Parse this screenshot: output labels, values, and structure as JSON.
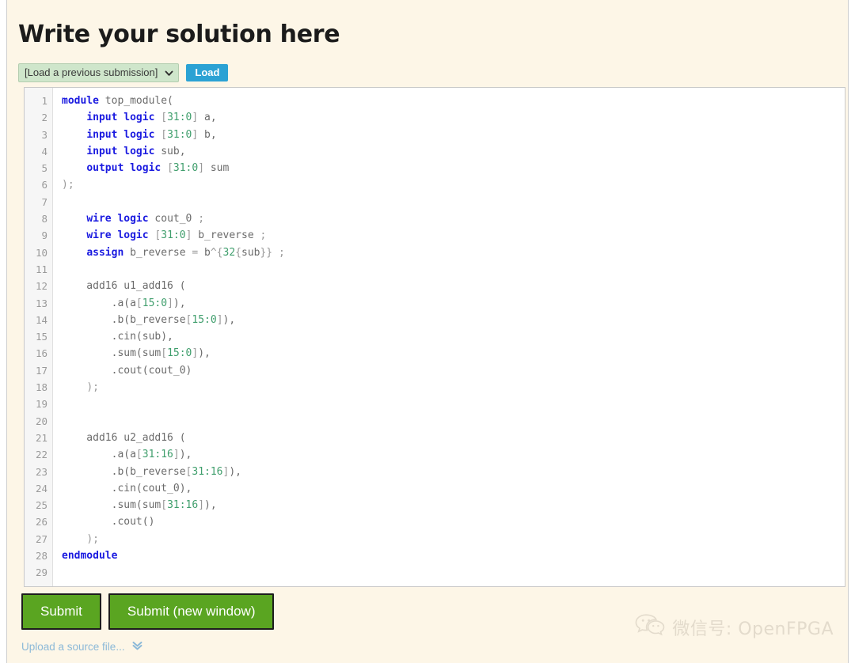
{
  "page": {
    "title": "Write your solution here",
    "background_color": "#fdf6e7"
  },
  "loader": {
    "select_value": "[Load a previous submission]",
    "select_icon": "chevron-down-icon",
    "load_button_label": "Load",
    "load_button_color": "#2ba2d4",
    "select_background_color": "#cfe6cb"
  },
  "editor": {
    "background_color": "#ffffff",
    "gutter_color": "#f6f6f6",
    "keyword_color": "#1a1ae0",
    "number_color": "#3f9e6c",
    "identifier_color": "#6b6b6b",
    "line_number_color": "#9a9a9a",
    "line_count": 29,
    "lines": [
      {
        "n": "1",
        "tokens": [
          {
            "t": "kw",
            "s": "module"
          },
          {
            "t": "id",
            "s": " top_module("
          }
        ]
      },
      {
        "n": "2",
        "tokens": [
          {
            "t": "id",
            "s": "    "
          },
          {
            "t": "kw",
            "s": "input logic"
          },
          {
            "t": "id",
            "s": " "
          },
          {
            "t": "punc",
            "s": "["
          },
          {
            "t": "num",
            "s": "31:0"
          },
          {
            "t": "punc",
            "s": "]"
          },
          {
            "t": "id",
            "s": " a,"
          }
        ]
      },
      {
        "n": "3",
        "tokens": [
          {
            "t": "id",
            "s": "    "
          },
          {
            "t": "kw",
            "s": "input logic"
          },
          {
            "t": "id",
            "s": " "
          },
          {
            "t": "punc",
            "s": "["
          },
          {
            "t": "num",
            "s": "31:0"
          },
          {
            "t": "punc",
            "s": "]"
          },
          {
            "t": "id",
            "s": " b,"
          }
        ]
      },
      {
        "n": "4",
        "tokens": [
          {
            "t": "id",
            "s": "    "
          },
          {
            "t": "kw",
            "s": "input logic"
          },
          {
            "t": "id",
            "s": " sub,"
          }
        ]
      },
      {
        "n": "5",
        "tokens": [
          {
            "t": "id",
            "s": "    "
          },
          {
            "t": "kw",
            "s": "output logic"
          },
          {
            "t": "id",
            "s": " "
          },
          {
            "t": "punc",
            "s": "["
          },
          {
            "t": "num",
            "s": "31:0"
          },
          {
            "t": "punc",
            "s": "]"
          },
          {
            "t": "id",
            "s": " sum"
          }
        ]
      },
      {
        "n": "6",
        "tokens": [
          {
            "t": "punc",
            "s": ");"
          }
        ]
      },
      {
        "n": "7",
        "tokens": []
      },
      {
        "n": "8",
        "tokens": [
          {
            "t": "id",
            "s": "    "
          },
          {
            "t": "kw",
            "s": "wire logic"
          },
          {
            "t": "id",
            "s": " cout_0 "
          },
          {
            "t": "punc",
            "s": ";"
          }
        ]
      },
      {
        "n": "9",
        "tokens": [
          {
            "t": "id",
            "s": "    "
          },
          {
            "t": "kw",
            "s": "wire logic"
          },
          {
            "t": "id",
            "s": " "
          },
          {
            "t": "punc",
            "s": "["
          },
          {
            "t": "num",
            "s": "31:0"
          },
          {
            "t": "punc",
            "s": "]"
          },
          {
            "t": "id",
            "s": " b_reverse "
          },
          {
            "t": "punc",
            "s": ";"
          }
        ]
      },
      {
        "n": "10",
        "tokens": [
          {
            "t": "id",
            "s": "    "
          },
          {
            "t": "kw",
            "s": "assign"
          },
          {
            "t": "id",
            "s": " b_reverse "
          },
          {
            "t": "punc",
            "s": "= "
          },
          {
            "t": "id",
            "s": "b"
          },
          {
            "t": "punc",
            "s": "^{"
          },
          {
            "t": "num",
            "s": "32"
          },
          {
            "t": "punc",
            "s": "{"
          },
          {
            "t": "id",
            "s": "sub"
          },
          {
            "t": "punc",
            "s": "}} ;"
          }
        ]
      },
      {
        "n": "11",
        "tokens": []
      },
      {
        "n": "12",
        "tokens": [
          {
            "t": "id",
            "s": "    add16 u1_add16 ("
          }
        ]
      },
      {
        "n": "13",
        "tokens": [
          {
            "t": "id",
            "s": "        .a(a"
          },
          {
            "t": "punc",
            "s": "["
          },
          {
            "t": "num",
            "s": "15:0"
          },
          {
            "t": "punc",
            "s": "]"
          },
          {
            "t": "id",
            "s": "),"
          }
        ]
      },
      {
        "n": "14",
        "tokens": [
          {
            "t": "id",
            "s": "        .b(b_reverse"
          },
          {
            "t": "punc",
            "s": "["
          },
          {
            "t": "num",
            "s": "15:0"
          },
          {
            "t": "punc",
            "s": "]"
          },
          {
            "t": "id",
            "s": "),"
          }
        ]
      },
      {
        "n": "15",
        "tokens": [
          {
            "t": "id",
            "s": "        .cin(sub),"
          }
        ]
      },
      {
        "n": "16",
        "tokens": [
          {
            "t": "id",
            "s": "        .sum(sum"
          },
          {
            "t": "punc",
            "s": "["
          },
          {
            "t": "num",
            "s": "15:0"
          },
          {
            "t": "punc",
            "s": "]"
          },
          {
            "t": "id",
            "s": "),"
          }
        ]
      },
      {
        "n": "17",
        "tokens": [
          {
            "t": "id",
            "s": "        .cout(cout_0)"
          }
        ]
      },
      {
        "n": "18",
        "tokens": [
          {
            "t": "id",
            "s": "    "
          },
          {
            "t": "punc",
            "s": ");"
          }
        ]
      },
      {
        "n": "19",
        "tokens": []
      },
      {
        "n": "20",
        "tokens": []
      },
      {
        "n": "21",
        "tokens": [
          {
            "t": "id",
            "s": "    add16 u2_add16 ("
          }
        ]
      },
      {
        "n": "22",
        "tokens": [
          {
            "t": "id",
            "s": "        .a(a"
          },
          {
            "t": "punc",
            "s": "["
          },
          {
            "t": "num",
            "s": "31:16"
          },
          {
            "t": "punc",
            "s": "]"
          },
          {
            "t": "id",
            "s": "),"
          }
        ]
      },
      {
        "n": "23",
        "tokens": [
          {
            "t": "id",
            "s": "        .b(b_reverse"
          },
          {
            "t": "punc",
            "s": "["
          },
          {
            "t": "num",
            "s": "31:16"
          },
          {
            "t": "punc",
            "s": "]"
          },
          {
            "t": "id",
            "s": "),"
          }
        ]
      },
      {
        "n": "24",
        "tokens": [
          {
            "t": "id",
            "s": "        .cin(cout_0),"
          }
        ]
      },
      {
        "n": "25",
        "tokens": [
          {
            "t": "id",
            "s": "        .sum(sum"
          },
          {
            "t": "punc",
            "s": "["
          },
          {
            "t": "num",
            "s": "31:16"
          },
          {
            "t": "punc",
            "s": "]"
          },
          {
            "t": "id",
            "s": "),"
          }
        ]
      },
      {
        "n": "26",
        "tokens": [
          {
            "t": "id",
            "s": "        .cout()"
          }
        ]
      },
      {
        "n": "27",
        "tokens": [
          {
            "t": "id",
            "s": "    "
          },
          {
            "t": "punc",
            "s": ");"
          }
        ]
      },
      {
        "n": "28",
        "tokens": [
          {
            "t": "kw",
            "s": "endmodule"
          }
        ]
      },
      {
        "n": "29",
        "tokens": []
      }
    ]
  },
  "actions": {
    "submit_label": "Submit",
    "submit_new_window_label": "Submit (new window)",
    "submit_button_color": "#5aa521",
    "upload_label": "Upload a source file...",
    "upload_icon": "double-chevron-down-icon"
  },
  "watermark": {
    "text": "微信号: OpenFPGA",
    "icon": "wechat-icon",
    "color": "#e3dbcc"
  }
}
